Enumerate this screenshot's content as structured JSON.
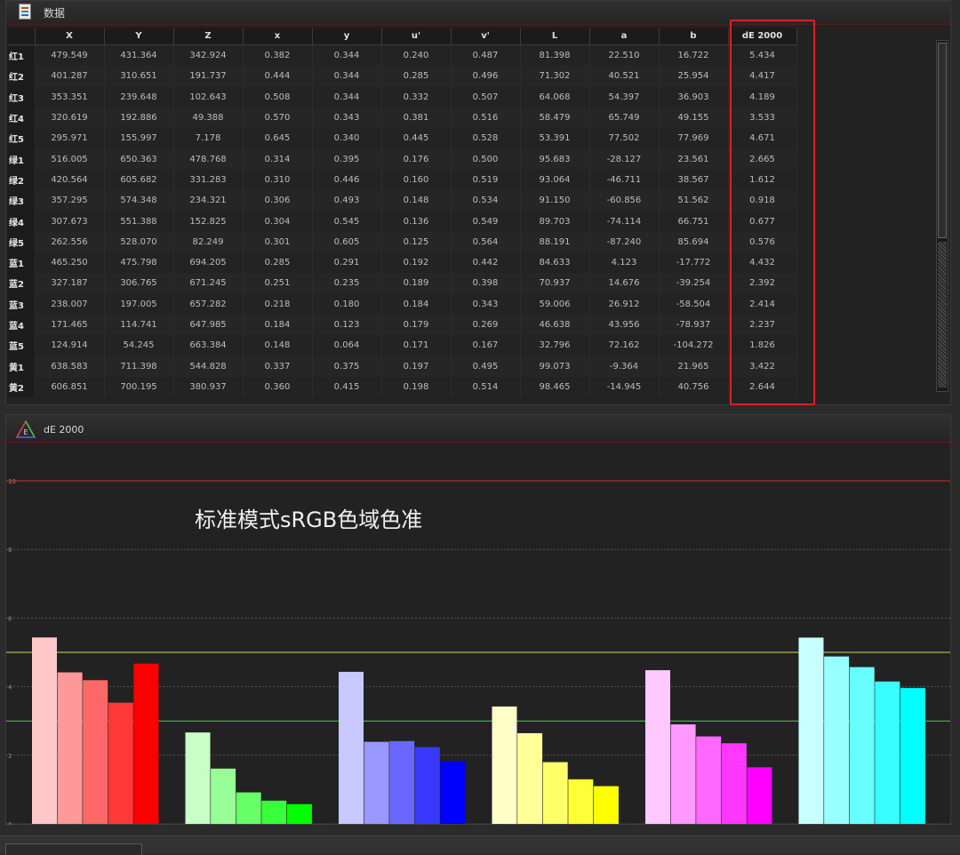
{
  "data_panel": {
    "title": "数据",
    "columns": [
      "",
      "X",
      "Y",
      "Z",
      "x",
      "y",
      "u'",
      "v'",
      "L",
      "a",
      "b",
      "dE 2000"
    ],
    "rows": [
      [
        "红1",
        "479.549",
        "431.364",
        "342.924",
        "0.382",
        "0.344",
        "0.240",
        "0.487",
        "81.398",
        "22.510",
        "16.722",
        "5.434"
      ],
      [
        "红2",
        "401.287",
        "310.651",
        "191.737",
        "0.444",
        "0.344",
        "0.285",
        "0.496",
        "71.302",
        "40.521",
        "25.954",
        "4.417"
      ],
      [
        "红3",
        "353.351",
        "239.648",
        "102.643",
        "0.508",
        "0.344",
        "0.332",
        "0.507",
        "64.068",
        "54.397",
        "36.903",
        "4.189"
      ],
      [
        "红4",
        "320.619",
        "192.886",
        "49.388",
        "0.570",
        "0.343",
        "0.381",
        "0.516",
        "58.479",
        "65.749",
        "49.155",
        "3.533"
      ],
      [
        "红5",
        "295.971",
        "155.997",
        "7.178",
        "0.645",
        "0.340",
        "0.445",
        "0.528",
        "53.391",
        "77.502",
        "77.969",
        "4.671"
      ],
      [
        "绿1",
        "516.005",
        "650.363",
        "478.768",
        "0.314",
        "0.395",
        "0.176",
        "0.500",
        "95.683",
        "-28.127",
        "23.561",
        "2.665"
      ],
      [
        "绿2",
        "420.564",
        "605.682",
        "331.283",
        "0.310",
        "0.446",
        "0.160",
        "0.519",
        "93.064",
        "-46.711",
        "38.567",
        "1.612"
      ],
      [
        "绿3",
        "357.295",
        "574.348",
        "234.321",
        "0.306",
        "0.493",
        "0.148",
        "0.534",
        "91.150",
        "-60.856",
        "51.562",
        "0.918"
      ],
      [
        "绿4",
        "307.673",
        "551.388",
        "152.825",
        "0.304",
        "0.545",
        "0.136",
        "0.549",
        "89.703",
        "-74.114",
        "66.751",
        "0.677"
      ],
      [
        "绿5",
        "262.556",
        "528.070",
        "82.249",
        "0.301",
        "0.605",
        "0.125",
        "0.564",
        "88.191",
        "-87.240",
        "85.694",
        "0.576"
      ],
      [
        "蓝1",
        "465.250",
        "475.798",
        "694.205",
        "0.285",
        "0.291",
        "0.192",
        "0.442",
        "84.633",
        "4.123",
        "-17.772",
        "4.432"
      ],
      [
        "蓝2",
        "327.187",
        "306.765",
        "671.245",
        "0.251",
        "0.235",
        "0.189",
        "0.398",
        "70.937",
        "14.676",
        "-39.254",
        "2.392"
      ],
      [
        "蓝3",
        "238.007",
        "197.005",
        "657.282",
        "0.218",
        "0.180",
        "0.184",
        "0.343",
        "59.006",
        "26.912",
        "-58.504",
        "2.414"
      ],
      [
        "蓝4",
        "171.465",
        "114.741",
        "647.985",
        "0.184",
        "0.123",
        "0.179",
        "0.269",
        "46.638",
        "43.956",
        "-78.937",
        "2.237"
      ],
      [
        "蓝5",
        "124.914",
        "54.245",
        "663.384",
        "0.148",
        "0.064",
        "0.171",
        "0.167",
        "32.796",
        "72.162",
        "-104.272",
        "1.826"
      ],
      [
        "黄1",
        "638.583",
        "711.398",
        "544.828",
        "0.337",
        "0.375",
        "0.197",
        "0.495",
        "99.073",
        "-9.364",
        "21.965",
        "3.422"
      ],
      [
        "黄2",
        "606.851",
        "700.195",
        "380.937",
        "0.360",
        "0.415",
        "0.198",
        "0.514",
        "98.465",
        "-14.945",
        "40.756",
        "2.644"
      ]
    ]
  },
  "chart_panel": {
    "title": "dE  2000"
  },
  "chart_data": {
    "type": "bar",
    "title": "标准模式sRGB色域色准",
    "ylim": [
      0,
      10
    ],
    "yticks": [
      0,
      2,
      4,
      6,
      8,
      10
    ],
    "reference_lines": [
      {
        "value": 10,
        "color": "#c83232"
      },
      {
        "value": 5,
        "color": "#d8d848"
      },
      {
        "value": 3,
        "color": "#48d048"
      }
    ],
    "grid": true,
    "groups": [
      {
        "colors": [
          "#ffc8c8",
          "#ff9898",
          "#ff6868",
          "#ff3838",
          "#ff0000"
        ],
        "values": [
          5.434,
          4.417,
          4.189,
          3.533,
          4.671
        ]
      },
      {
        "colors": [
          "#c8ffc8",
          "#98ff98",
          "#68ff68",
          "#38ff38",
          "#00ff00"
        ],
        "values": [
          2.665,
          1.612,
          0.918,
          0.677,
          0.576
        ]
      },
      {
        "colors": [
          "#c8c8ff",
          "#9898ff",
          "#6868ff",
          "#3838ff",
          "#0000ff"
        ],
        "values": [
          4.432,
          2.392,
          2.414,
          2.237,
          1.826
        ]
      },
      {
        "colors": [
          "#ffffc8",
          "#ffff98",
          "#ffff68",
          "#ffff38",
          "#ffff00"
        ],
        "values": [
          3.422,
          2.644,
          1.8,
          1.3,
          1.1
        ]
      },
      {
        "colors": [
          "#ffc8ff",
          "#ff98ff",
          "#ff68ff",
          "#ff38ff",
          "#ff00ff"
        ],
        "values": [
          4.48,
          2.9,
          2.55,
          2.35,
          1.65
        ]
      },
      {
        "colors": [
          "#c8ffff",
          "#98ffff",
          "#68ffff",
          "#38ffff",
          "#00ffff"
        ],
        "values": [
          5.43,
          4.88,
          4.57,
          4.15,
          3.96
        ]
      }
    ]
  }
}
